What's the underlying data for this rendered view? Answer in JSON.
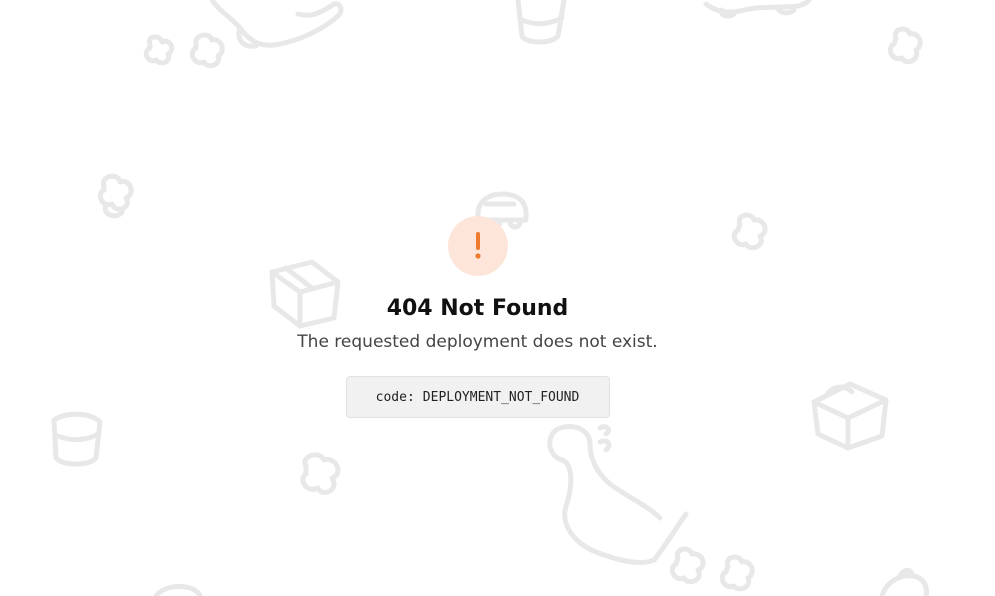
{
  "error": {
    "title": "404 Not Found",
    "message": "The requested deployment does not exist.",
    "code_label": "code:",
    "code_value": "DEPLOYMENT_NOT_FOUND",
    "icon": "exclamation-icon",
    "accent_color": "#f07a2e",
    "badge_color": "#fde6d9"
  },
  "background": {
    "doodle_color": "#e8e8e8",
    "doodles": [
      "dinosaur-icon",
      "bucket-icon",
      "flower-icon",
      "box-icon",
      "car-icon",
      "crab-icon"
    ]
  }
}
